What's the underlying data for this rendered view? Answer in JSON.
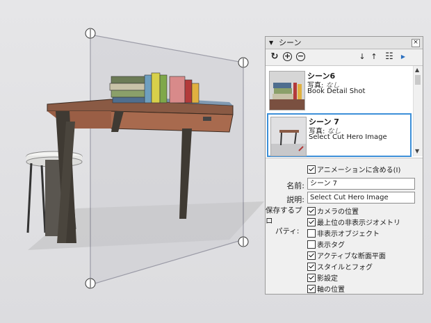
{
  "tray": {
    "title": "シーン",
    "collapse_glyph": "▼",
    "close_glyph": "×"
  },
  "toolbar": {
    "update_glyph": "↻",
    "add_glyph": "+",
    "remove_glyph": "−",
    "move_down_glyph": "↓",
    "move_up_glyph": "↑",
    "view_options_glyph": "☷",
    "details_glyph": "▶"
  },
  "scenes": [
    {
      "name": "シーン6",
      "photo_label": "写真:",
      "photo_value": "なし",
      "description": "Book Detail Shot",
      "selected": false
    },
    {
      "name": "シーン 7",
      "photo_label": "写真:",
      "photo_value": "なし",
      "description": "Select Cut Hero Image",
      "selected": true
    }
  ],
  "properties": {
    "include_in_animation": {
      "label": "アニメーションに含める(I)",
      "checked": true
    },
    "name_label": "名前:",
    "name_value": "シーン 7",
    "description_label": "説明:",
    "description_value": "Select Cut Hero Image",
    "save_props_label_1": "保存するプロ",
    "save_props_label_2": "パティ:",
    "save_props": [
      {
        "label": "カメラの位置",
        "checked": true
      },
      {
        "label": "最上位の非表示ジオメトリ",
        "checked": true
      },
      {
        "label": "非表示オブジェクト",
        "checked": false
      },
      {
        "label": "表示タグ",
        "checked": false
      },
      {
        "label": "アクティブな断面平面",
        "checked": true
      },
      {
        "label": "スタイルとフォグ",
        "checked": true
      },
      {
        "label": "影設定",
        "checked": true
      },
      {
        "label": "軸の位置",
        "checked": true
      }
    ]
  },
  "colors": {
    "selection_border": "#3c8fd8",
    "desk_top": "#8a5a44",
    "desk_legs": "#3f3a33",
    "section_plane": "#b8b8c0"
  }
}
